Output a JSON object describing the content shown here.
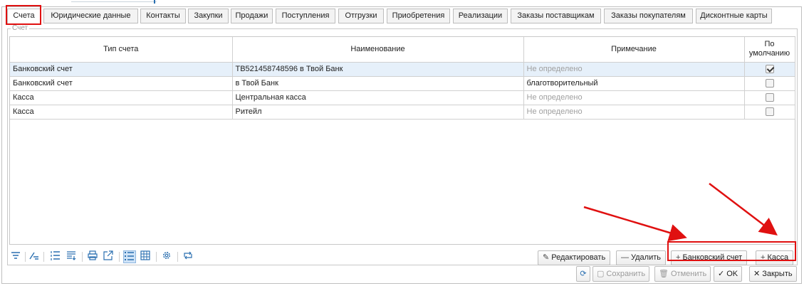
{
  "tabs": [
    {
      "label": "Счета",
      "active": true
    },
    {
      "label": "Юридические данные"
    },
    {
      "label": "Контакты"
    },
    {
      "label": "Закупки"
    },
    {
      "label": "Продажи"
    },
    {
      "label": "Поступления"
    },
    {
      "label": "Отгрузки"
    },
    {
      "label": "Приобретения"
    },
    {
      "label": "Реализации"
    },
    {
      "label": "Заказы поставщикам"
    },
    {
      "label": "Заказы покупателям"
    },
    {
      "label": "Дисконтные карты"
    }
  ],
  "panel": {
    "legend": "Счет"
  },
  "table": {
    "headers": [
      "Тип счета",
      "Наименование",
      "Примечание",
      "По умолчанию"
    ],
    "rows": [
      {
        "type": "Банковский счет",
        "name": "ТВ521458748596 в Твой Банк",
        "note": "Не определено",
        "note_muted": true,
        "default": true
      },
      {
        "type": "Банковский счет",
        "name": "в Твой Банк",
        "note": "благотворительный",
        "note_muted": false,
        "default": false
      },
      {
        "type": "Касса",
        "name": "Центральная касса",
        "note": "Не определено",
        "note_muted": true,
        "default": false
      },
      {
        "type": "Касса",
        "name": "Ритейл",
        "note": "Не определено",
        "note_muted": true,
        "default": false
      }
    ]
  },
  "actions": {
    "edit": "Редактировать",
    "delete": "Удалить",
    "add_bank": "Банковский счет",
    "add_cash": "Касса"
  },
  "footer": {
    "save": "Сохранить",
    "cancel": "Отменить",
    "ok": "OK",
    "close": "Закрыть"
  },
  "colors": {
    "highlight": "#e01010",
    "selected_row": "#e6f0fa",
    "accent": "#2a6fb0"
  }
}
